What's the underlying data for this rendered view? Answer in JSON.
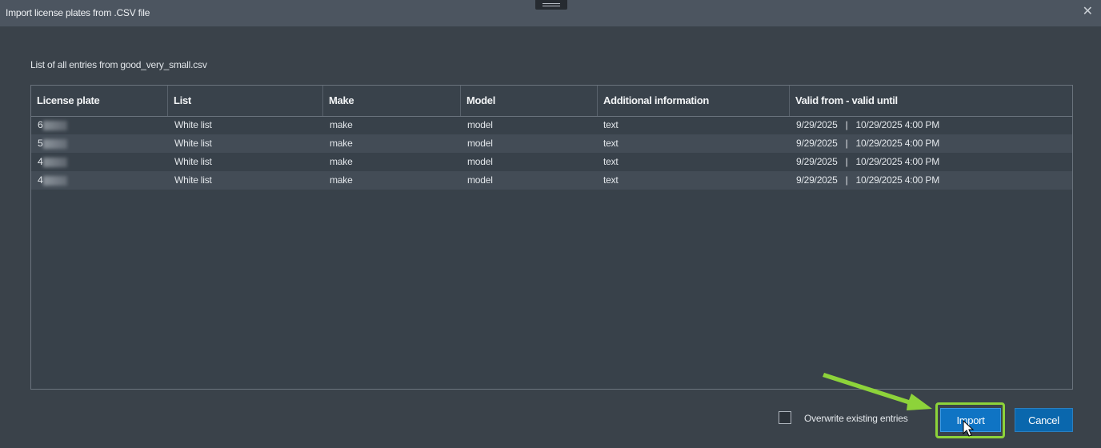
{
  "window": {
    "title": "Import license plates from .CSV file",
    "close_glyph": "✕"
  },
  "subtitle": "List of all entries from good_very_small.csv",
  "table": {
    "columns": [
      "License plate",
      "List",
      "Make",
      "Model",
      "Additional information",
      "Valid from - valid until"
    ],
    "rows": [
      {
        "plate": "6",
        "list": "White list",
        "make": "make",
        "model": "model",
        "info": "text",
        "from": "9/29/2025",
        "sep": "|",
        "until": "10/29/2025 4:00 PM"
      },
      {
        "plate": "5",
        "list": "White list",
        "make": "make",
        "model": "model",
        "info": "text",
        "from": "9/29/2025",
        "sep": "|",
        "until": "10/29/2025 4:00 PM"
      },
      {
        "plate": "4",
        "list": "White list",
        "make": "make",
        "model": "model",
        "info": "text",
        "from": "9/29/2025",
        "sep": "|",
        "until": "10/29/2025 4:00 PM"
      },
      {
        "plate": "4",
        "list": "White list",
        "make": "make",
        "model": "model",
        "info": "text",
        "from": "9/29/2025",
        "sep": "|",
        "until": "10/29/2025 4:00 PM"
      }
    ]
  },
  "overwrite": {
    "label": "Overwrite existing entries",
    "checked": false
  },
  "buttons": {
    "import": "Import",
    "cancel": "Cancel"
  },
  "colors": {
    "background": "#3a424a",
    "titlebar": "#4c5560",
    "primary_button": "#0f74c4",
    "highlight": "#8dd33a"
  }
}
